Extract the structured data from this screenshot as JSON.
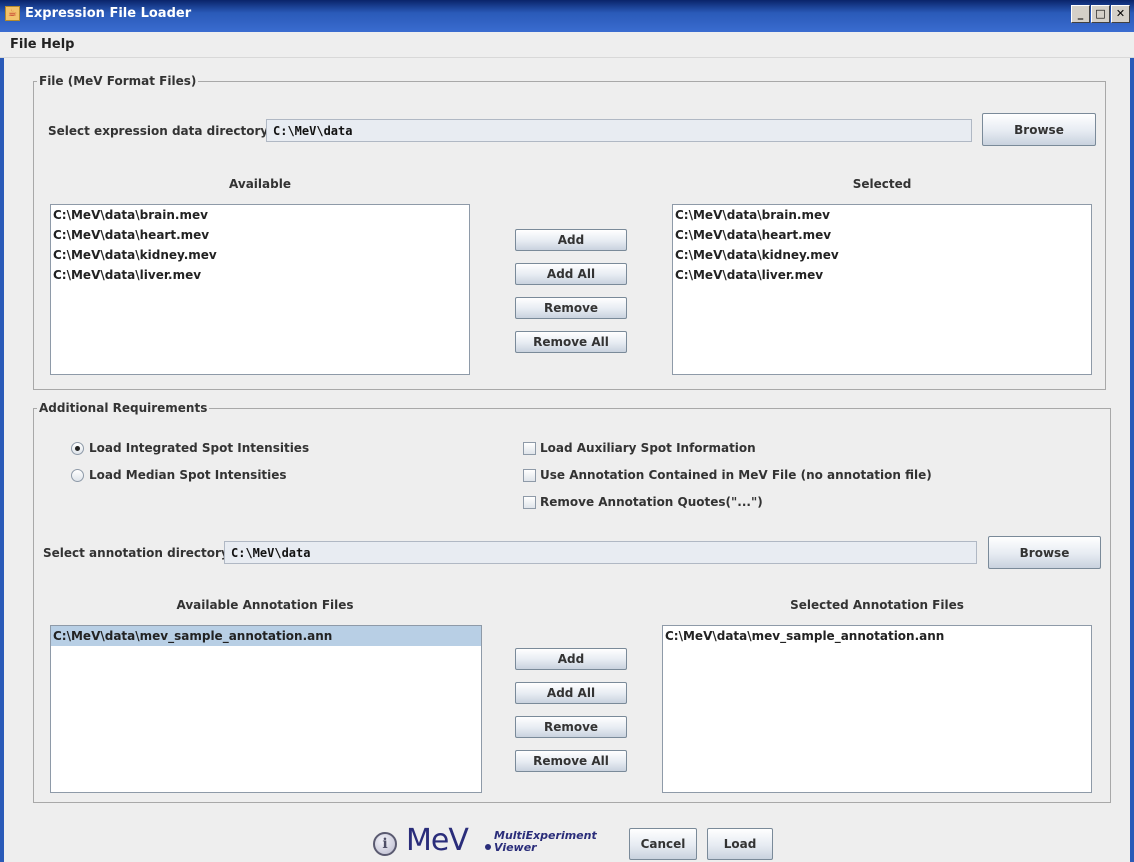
{
  "window": {
    "title": "Expression File Loader",
    "icon": "java-cup-icon",
    "controls": [
      "minimize",
      "maximize",
      "close"
    ]
  },
  "menu": [
    "File",
    "Help"
  ],
  "file_section": {
    "legend": "File   (MeV Format Files)",
    "dir_label": "Select expression data directory",
    "dir_value": "C:\\MeV\\data",
    "browse_label": "Browse",
    "available_header": "Available",
    "selected_header": "Selected",
    "available": [
      "C:\\MeV\\data\\brain.mev",
      "C:\\MeV\\data\\heart.mev",
      "C:\\MeV\\data\\kidney.mev",
      "C:\\MeV\\data\\liver.mev"
    ],
    "selected": [
      "C:\\MeV\\data\\brain.mev",
      "C:\\MeV\\data\\heart.mev",
      "C:\\MeV\\data\\kidney.mev",
      "C:\\MeV\\data\\liver.mev"
    ],
    "buttons": {
      "add": "Add",
      "add_all": "Add All",
      "remove": "Remove",
      "remove_all": "Remove All"
    }
  },
  "requirements": {
    "legend": "Additional Requirements",
    "radios": [
      {
        "label": "Load Integrated Spot Intensities",
        "selected": true
      },
      {
        "label": "Load Median Spot Intensities",
        "selected": false
      }
    ],
    "checkboxes": [
      {
        "label": "Load Auxiliary Spot Information",
        "checked": false
      },
      {
        "label": "Use Annotation Contained in MeV File (no annotation file)",
        "checked": false
      },
      {
        "label": "Remove Annotation Quotes(\"...\")",
        "checked": false
      }
    ],
    "ann_dir_label": "Select annotation directory",
    "ann_dir_value": "C:\\MeV\\data",
    "browse_label": "Browse",
    "available_header": "Available Annotation Files",
    "selected_header": "Selected Annotation Files",
    "available": [
      "C:\\MeV\\data\\mev_sample_annotation.ann"
    ],
    "selected": [
      "C:\\MeV\\data\\mev_sample_annotation.ann"
    ],
    "buttons": {
      "add": "Add",
      "add_all": "Add All",
      "remove": "Remove",
      "remove_all": "Remove All"
    }
  },
  "footer": {
    "logo_text": "MeV",
    "logo_sub_1": "MultiExperiment",
    "logo_sub_2": "Viewer",
    "cancel_label": "Cancel",
    "load_label": "Load"
  }
}
